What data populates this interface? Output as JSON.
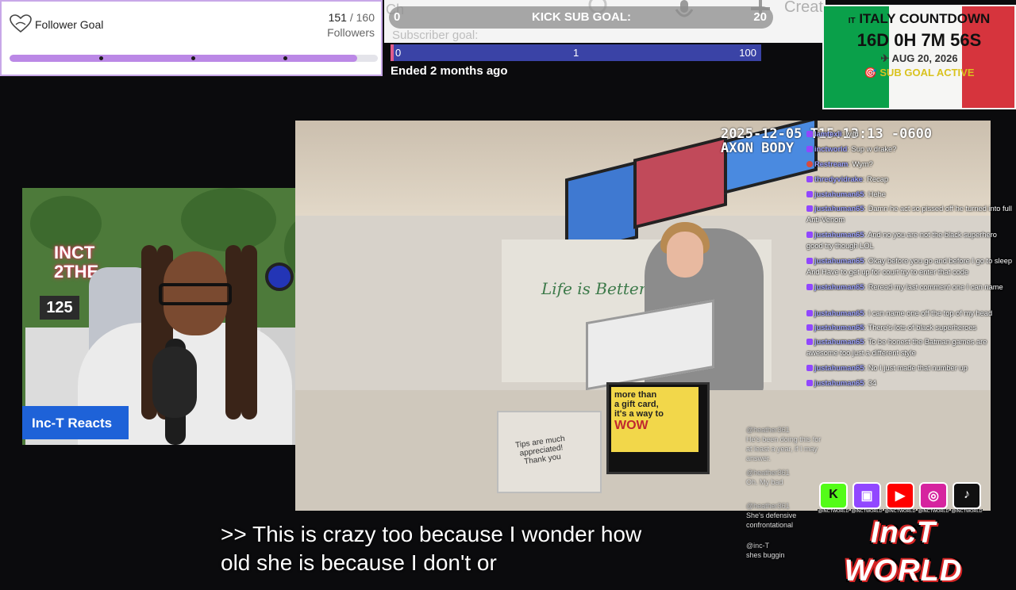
{
  "follower_goal": {
    "title": "Follower Goal",
    "current": "151",
    "separator": " / ",
    "target": "160",
    "unit": "Followers",
    "progress_fraction": 0.944,
    "bar_color": "#bb88e6"
  },
  "kick_sub_goal": {
    "left_value": "0",
    "label": "KICK SUB GOAL:",
    "right_value": "20"
  },
  "top_ghost": {
    "ch_text": "Ch",
    "create_text": "Creat"
  },
  "subscriber_goal": {
    "label": "Subscriber goal:",
    "start": "0",
    "mid": "1",
    "end": "100",
    "bar_color": "#3a43a6",
    "status": "Ended 2 months ago"
  },
  "italy_countdown": {
    "flag_prefix": "IT",
    "title": "ITALY COUNTDOWN",
    "time_left": "16D 0H 7M 56S",
    "date": "AUG 20, 2026",
    "date_icon": "✈",
    "status": "SUB GOAL ACTIVE",
    "status_icon": "🎯",
    "colors": {
      "green": "#0aa04a",
      "white": "#f6f6f4",
      "red": "#d6343d"
    }
  },
  "webcam": {
    "neon_sign_line1": "INCT",
    "neon_sign_line2": "2THE",
    "sign_number": "125",
    "badge_label": "Inc-T Reacts",
    "badge_color": "#1e62d8"
  },
  "video": {
    "timestamp": "2025-12-05 T15:13:13 -0600",
    "camera_label": "AXON BODY",
    "wall_sign": "Life is Better with Treats",
    "pos_ad_line1": "more than",
    "pos_ad_line2": "a gift card,",
    "pos_ad_line3": "it's a way to",
    "pos_ad_line4": "WOW",
    "tip_note": "Tips are much appreciated! Thank you"
  },
  "chat_messages": [
    {
      "user": "lamtexii",
      "text": "wild",
      "badge": "twitch"
    },
    {
      "user": "inctworld",
      "text": "Sup w drake?",
      "badge": "twitch"
    },
    {
      "user": "Restream",
      "text": "Wym?",
      "badge": "kick"
    },
    {
      "user": "thredyvidrake",
      "text": "Recap",
      "badge": "twitch"
    },
    {
      "user": "justahuman65",
      "text": "Hehe",
      "badge": "twitch"
    },
    {
      "user": "justahuman65",
      "text": "Damn he act so pissed off he turned into full Anti-Venom",
      "badge": "twitch"
    },
    {
      "user": "justahuman65",
      "text": "And no you are not the black superhero good try though LOL",
      "badge": "twitch"
    },
    {
      "user": "justahuman65",
      "text": "Okay before you go and before I go to sleep And Have to get up for court try to enter that code",
      "badge": "twitch"
    },
    {
      "user": "justahuman65",
      "text": "Reread my last comment one I can name",
      "badge": "twitch"
    },
    {
      "user": "justahuman65",
      "text": "I can name one off the top of my head",
      "badge": "twitch"
    },
    {
      "user": "justahuman65",
      "text": "There's lots of black superheroes",
      "badge": "twitch"
    },
    {
      "user": "justahuman65",
      "text": "To be honest the Batman games are awesome too just a different style",
      "badge": "twitch"
    },
    {
      "user": "justahuman65",
      "text": "No I just made that number up",
      "badge": "twitch"
    },
    {
      "user": "justahuman65",
      "text": "34",
      "badge": "twitch"
    }
  ],
  "overlay_chat": [
    {
      "user": "@heather361",
      "text": "He's been doing this for at least a year, if I may answer."
    },
    {
      "user": "@heather361",
      "text": "Oh. My bad"
    },
    {
      "user": "@heather361",
      "text": "She's defensive confrontational"
    },
    {
      "user": "@inc-T",
      "text": "shes buggin"
    }
  ],
  "socials": {
    "kick": {
      "glyph": "K",
      "handle": "@INCTWORLD",
      "color": "#53fc18"
    },
    "twitch": {
      "glyph": "▣",
      "handle": "@INCTWORLD",
      "color": "#9147ff"
    },
    "youtube": {
      "glyph": "▶",
      "handle": "@INCTWORLD",
      "color": "#ff0000"
    },
    "instagram": {
      "glyph": "◎",
      "handle": "@INCTWORLD",
      "color": "#d6249f"
    },
    "tiktok": {
      "glyph": "♪",
      "handle": "@INCTWORLD",
      "color": "#111111"
    },
    "brand": "IncT WORLD"
  },
  "subtitle": {
    "line1": ">> This is crazy too because I wonder how",
    "line2": "old she is because I don't or"
  }
}
